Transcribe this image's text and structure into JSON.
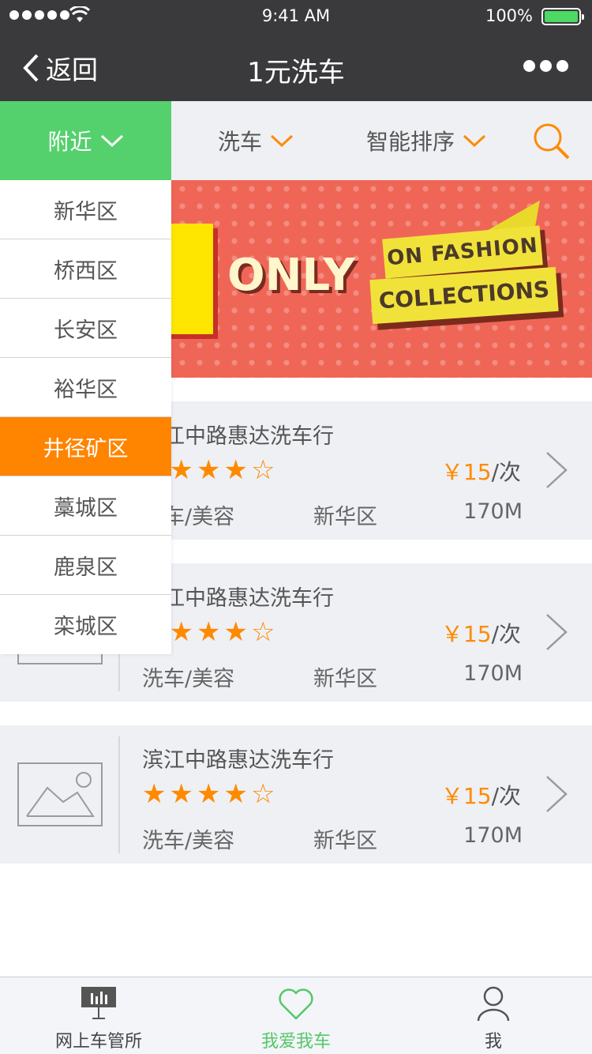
{
  "status_bar": {
    "time": "9:41 AM",
    "battery": "100%"
  },
  "nav": {
    "back_label": "返回",
    "title": "1元洗车"
  },
  "filters": {
    "nearby": "附近",
    "wash": "洗车",
    "sort": "智能排序"
  },
  "banner": {
    "headline": "ONLY",
    "ribbon_top": "ON FASHION",
    "ribbon_bottom": "COLLECTIONS"
  },
  "dropdown": {
    "options": [
      "新华区",
      "桥西区",
      "长安区",
      "裕华区",
      "井径矿区",
      "藁城区",
      "鹿泉区",
      "栾城区"
    ],
    "selected": "井径矿区"
  },
  "listings": [
    {
      "name": "滨江中路惠达洗车行",
      "rating": 4,
      "price": "￥15",
      "unit": "/次",
      "category": "洗车/美容",
      "district": "新华区",
      "distance": "170M"
    },
    {
      "name": "滨江中路惠达洗车行",
      "rating": 4,
      "price": "￥15",
      "unit": "/次",
      "category": "洗车/美容",
      "district": "新华区",
      "distance": "170M"
    },
    {
      "name": "滨江中路惠达洗车行",
      "rating": 4,
      "price": "￥15",
      "unit": "/次",
      "category": "洗车/美容",
      "district": "新华区",
      "distance": "170M"
    }
  ],
  "tabs": {
    "items": [
      "网上车管所",
      "我爱我车",
      "我"
    ],
    "active": "我爱我车"
  },
  "colors": {
    "accent_green": "#54d16c",
    "accent_orange": "#ff8a00",
    "nav_bg": "#3a3a3c"
  }
}
